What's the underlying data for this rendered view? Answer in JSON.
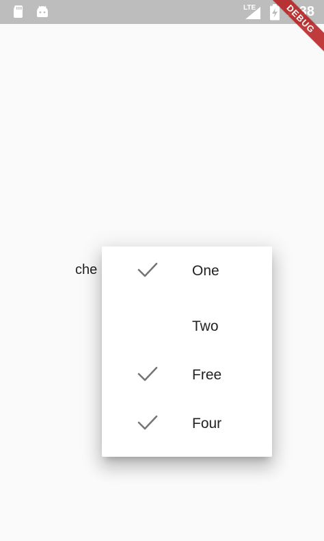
{
  "status_bar": {
    "network": "LTE",
    "time": "2:38",
    "icons": [
      "sd-card-icon",
      "android-icon",
      "signal-icon",
      "battery-charging-icon"
    ]
  },
  "debug_banner": "DEBUG",
  "background": {
    "text": "che"
  },
  "popup_menu": {
    "items": [
      {
        "label": "One",
        "checked": true
      },
      {
        "label": "Two",
        "checked": false
      },
      {
        "label": "Free",
        "checked": true
      },
      {
        "label": "Four",
        "checked": true
      }
    ]
  },
  "colors": {
    "status_bar": "#bdbdbd",
    "background": "#fafafa",
    "check": "#757575",
    "debug_ribbon": "#b71c1c"
  }
}
